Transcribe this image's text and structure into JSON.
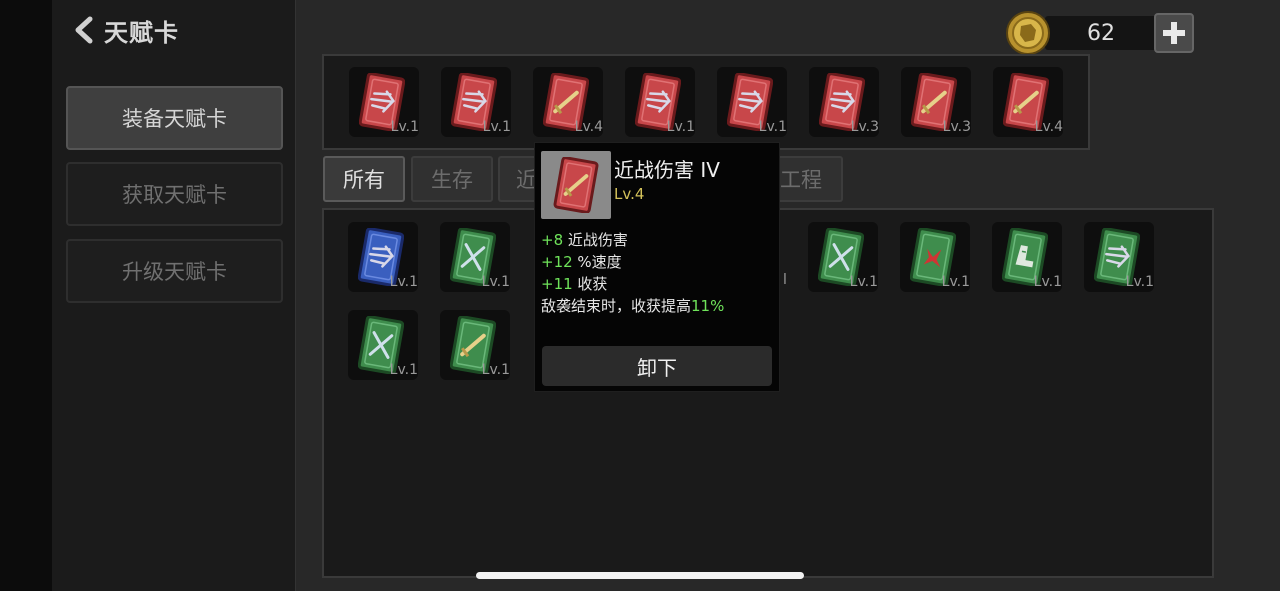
{
  "header": {
    "back_label": "天赋卡"
  },
  "sidebar": {
    "items": [
      {
        "label": "装备天赋卡",
        "active": true
      },
      {
        "label": "获取天赋卡",
        "active": false
      },
      {
        "label": "升级天赋卡",
        "active": false
      }
    ]
  },
  "currency": {
    "amount": "62",
    "icon": "coin-icon"
  },
  "equipped": [
    {
      "color": "red",
      "icon": "wind",
      "level": "Lv.1"
    },
    {
      "color": "red",
      "icon": "wind",
      "level": "Lv.1"
    },
    {
      "color": "red",
      "icon": "sword",
      "level": "Lv.4"
    },
    {
      "color": "red",
      "icon": "wind",
      "level": "Lv.1"
    },
    {
      "color": "red",
      "icon": "wind",
      "level": "Lv.1"
    },
    {
      "color": "red",
      "icon": "wind",
      "level": "Lv.3"
    },
    {
      "color": "red",
      "icon": "sword",
      "level": "Lv.3"
    },
    {
      "color": "red",
      "icon": "sword",
      "level": "Lv.4"
    }
  ],
  "tabs": [
    {
      "label": "所有",
      "active": true
    },
    {
      "label": "生存",
      "active": false
    },
    {
      "label": "近",
      "active": false
    },
    {
      "label": "工程",
      "active": false
    }
  ],
  "inventory": [
    {
      "color": "blue",
      "icon": "wind",
      "level": "Lv.1"
    },
    {
      "color": "green",
      "icon": "cross",
      "level": "Lv.1"
    },
    {
      "color": "green",
      "icon": "cross",
      "level": "Lv.1"
    },
    {
      "color": "green",
      "icon": "mark",
      "level": "Lv.1"
    },
    {
      "color": "green",
      "icon": "boot",
      "level": "Lv.1"
    },
    {
      "color": "green",
      "icon": "wind",
      "level": "Lv.1"
    },
    {
      "color": "green",
      "icon": "cross",
      "level": "Lv.1"
    },
    {
      "color": "green",
      "icon": "sword",
      "level": "Lv.1"
    }
  ],
  "hidden_inventory_levels": [
    "l"
  ],
  "tooltip": {
    "name": "近战伤害 IV",
    "level": "Lv.4",
    "stats": [
      {
        "value": "+8",
        "label": " 近战伤害"
      },
      {
        "value": "+12",
        "label": " %速度"
      },
      {
        "value": "+11",
        "label": " 收获"
      }
    ],
    "effect_text": "敌袭结束时，收获提高",
    "effect_value": "11%",
    "unequip_label": "卸下"
  },
  "colors": {
    "card_red": "#c8474a",
    "card_blue": "#3a5fbf",
    "card_green": "#3f8d4d",
    "stat_green": "#6fe35a",
    "level_yellow": "#d4c25a"
  }
}
